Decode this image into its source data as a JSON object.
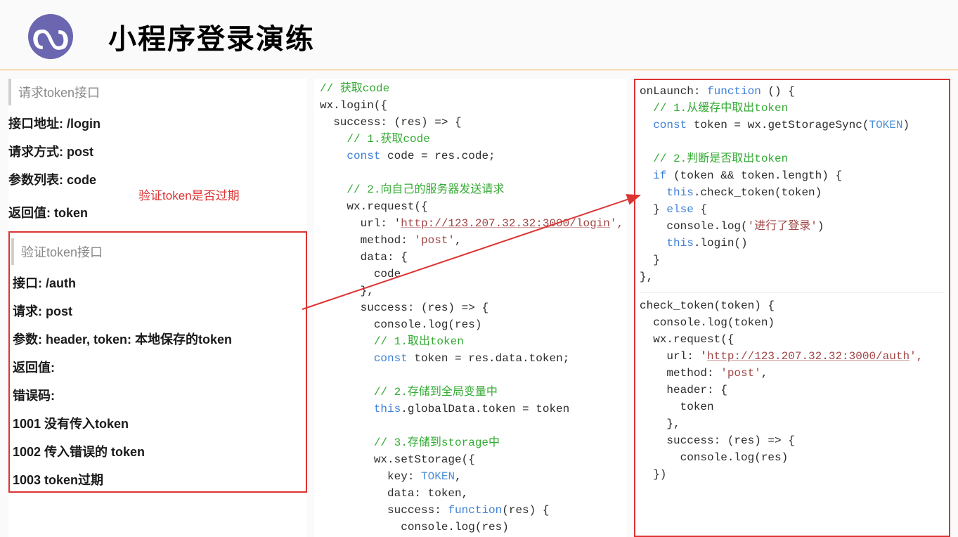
{
  "header": {
    "logo_glyph": "ᔓ",
    "title": "小程序登录演练"
  },
  "left": {
    "section1_title": "请求token接口",
    "items1": {
      "addr": "接口地址: /login",
      "method": "请求方式: post",
      "params": "参数列表: code",
      "return": "返回值: token"
    },
    "note": "验证token是否过期",
    "section2_title": "验证token接口",
    "items2": {
      "addr": "接口: /auth",
      "method": "请求: post",
      "params": "参数: header, token: 本地保存的token",
      "return": "返回值:",
      "errcode_label": "错误码:",
      "e1001": "1001 没有传入token",
      "e1002": "1002 传入错误的 token",
      "e1003": "1003 token过期"
    }
  },
  "middle_code": {
    "l1": "// 获取code",
    "l2": "wx.login({",
    "l3": "  success: (res) => {",
    "l4": "    // 1.获取code",
    "l5": "    const code = res.code;",
    "l6": "",
    "l7": "    // 2.向自己的服务器发送请求",
    "l8": "    wx.request({",
    "l9_pre": "      url: '",
    "l9_url": "http://123.207.32.32:3000/login",
    "l9_post": "',",
    "l10": "      method: 'post',",
    "l11": "      data: {",
    "l12": "        code",
    "l13": "      },",
    "l14": "      success: (res) => {",
    "l15": "        console.log(res)",
    "l16": "        // 1.取出token",
    "l17": "        const token = res.data.token;",
    "l18": "",
    "l19": "        // 2.存储到全局变量中",
    "l20": "        this.globalData.token = token",
    "l21": "",
    "l22": "        // 3.存储到storage中",
    "l23": "        wx.setStorage({",
    "l24": "          key: TOKEN,",
    "l25": "          data: token,",
    "l26": "          success: function(res) {",
    "l27": "            console.log(res)"
  },
  "right_code_top": {
    "l1a": "onLaunch: ",
    "l1b": "function",
    "l1c": " () {",
    "l2": "  // 1.从缓存中取出token",
    "l3a": "  const",
    "l3b": " token = wx.getStorageSync(",
    "l3c": "TOKEN",
    "l3d": ")",
    "l4": "",
    "l5": "  // 2.判断是否取出token",
    "l6a": "  if",
    "l6b": " (token && token.length) {",
    "l7a": "    this",
    "l7b": ".check_token(token)",
    "l8a": "  } ",
    "l8b": "else",
    "l8c": " {",
    "l9a": "    console.log(",
    "l9b": "'进行了登录'",
    "l9c": ")",
    "l10a": "    this",
    "l10b": ".login()",
    "l11": "  }",
    "l12": "},"
  },
  "right_code_bottom": {
    "l1": "check_token(token) {",
    "l2": "  console.log(token)",
    "l3": "  wx.request({",
    "l4a": "    url: '",
    "l4b": "http://123.207.32.32:3000/auth",
    "l4c": "',",
    "l5a": "    method: ",
    "l5b": "'post'",
    "l5c": ",",
    "l6": "    header: {",
    "l7": "      token",
    "l8": "    },",
    "l9": "    success: (res) => {",
    "l10": "      console.log(res)",
    "unused_brace": "}",
    "l11": "  })"
  }
}
